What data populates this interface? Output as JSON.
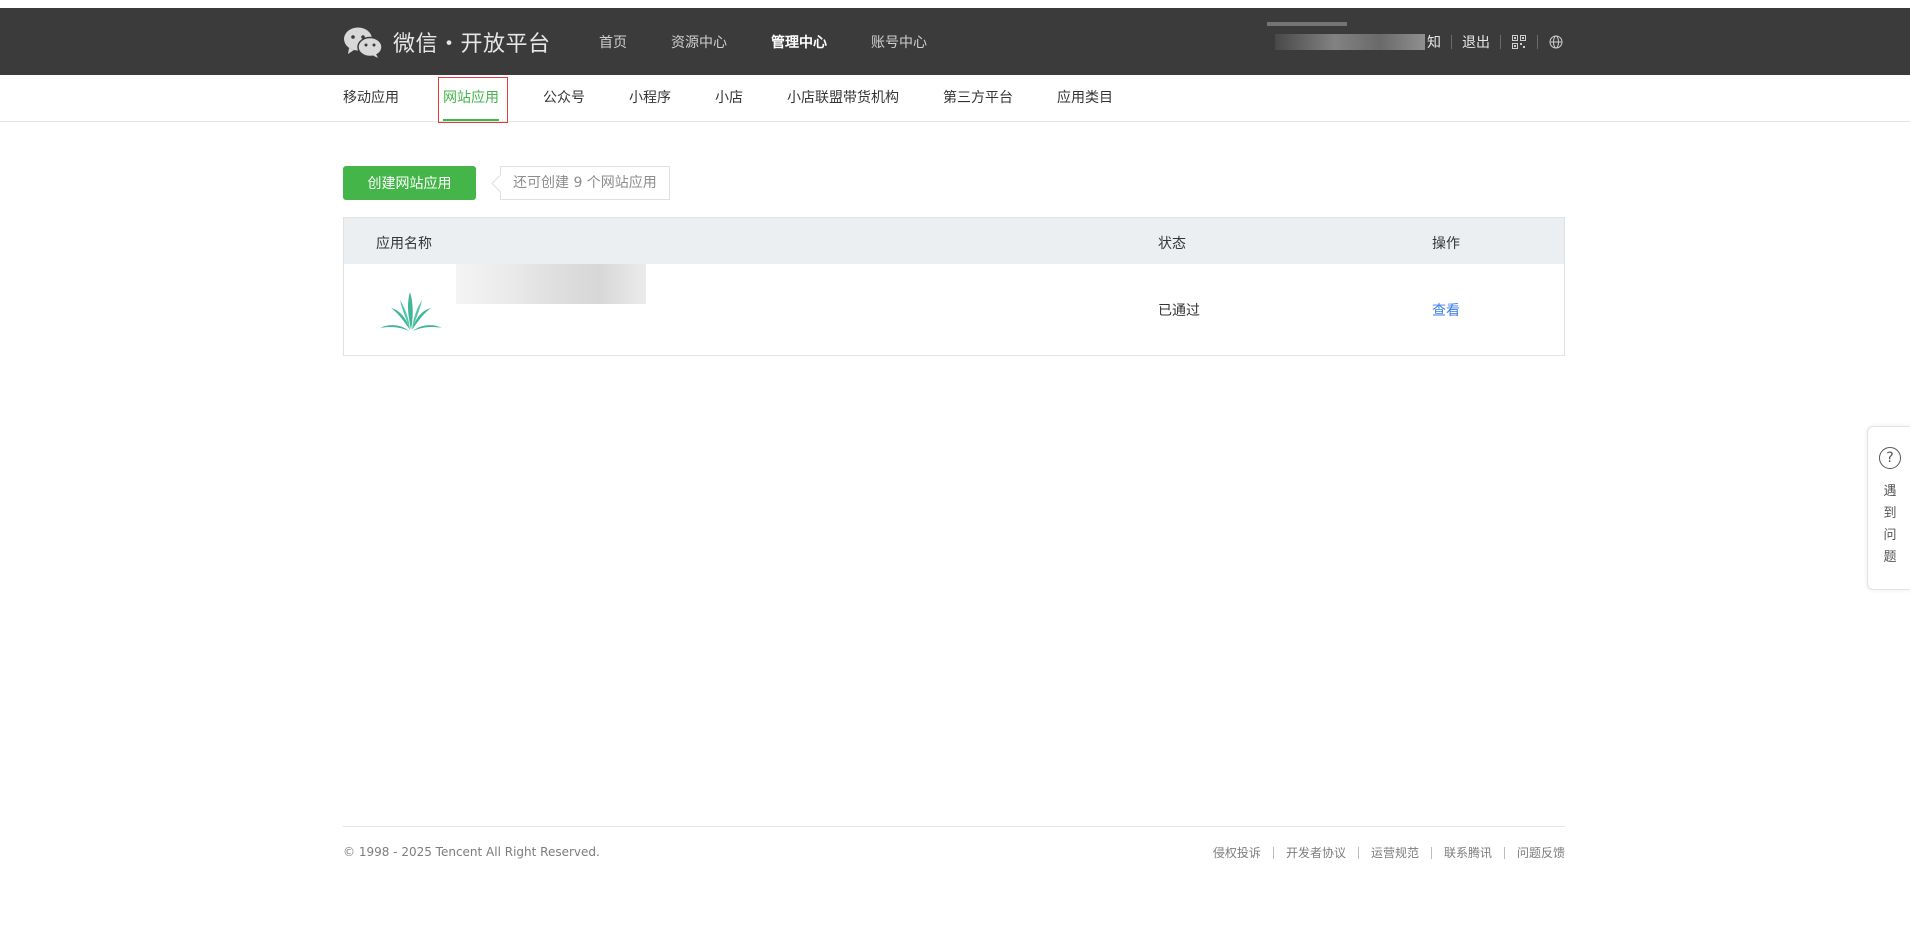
{
  "header": {
    "brand": "微信・开放平台",
    "nav": [
      {
        "label": "首页",
        "active": false
      },
      {
        "label": "资源中心",
        "active": false
      },
      {
        "label": "管理中心",
        "active": true
      },
      {
        "label": "账号中心",
        "active": false
      }
    ],
    "user_suffix": "知",
    "logout": "退出"
  },
  "subnav": {
    "items": [
      {
        "label": "移动应用",
        "active": false
      },
      {
        "label": "网站应用",
        "active": true
      },
      {
        "label": "公众号",
        "active": false
      },
      {
        "label": "小程序",
        "active": false
      },
      {
        "label": "小店",
        "active": false
      },
      {
        "label": "小店联盟带货机构",
        "active": false
      },
      {
        "label": "第三方平台",
        "active": false
      },
      {
        "label": "应用类目",
        "active": false
      }
    ]
  },
  "main": {
    "create_button": "创建网站应用",
    "quota_tip": "还可创建 9 个网站应用",
    "table": {
      "headers": {
        "name": "应用名称",
        "status": "状态",
        "action": "操作"
      },
      "rows": [
        {
          "status": "已通过",
          "action": "查看"
        }
      ]
    }
  },
  "footer": {
    "copyright": "© 1998 - 2025 Tencent All Right Reserved.",
    "links": [
      "侵权投诉",
      "开发者协议",
      "运营规范",
      "联系腾讯",
      "问题反馈"
    ]
  },
  "help": {
    "icon": "?",
    "text": "遇到问题"
  },
  "colors": {
    "accent": "#44b549",
    "link": "#3b7ee8",
    "topbar": "#3b3b3b",
    "highlight": "#e43c3c"
  },
  "icons": {
    "brand": "wechat-logo-icon",
    "qr": "qrcode-icon",
    "globe": "globe-icon",
    "app": "app-leaf-icon",
    "help": "question-circle-icon"
  }
}
